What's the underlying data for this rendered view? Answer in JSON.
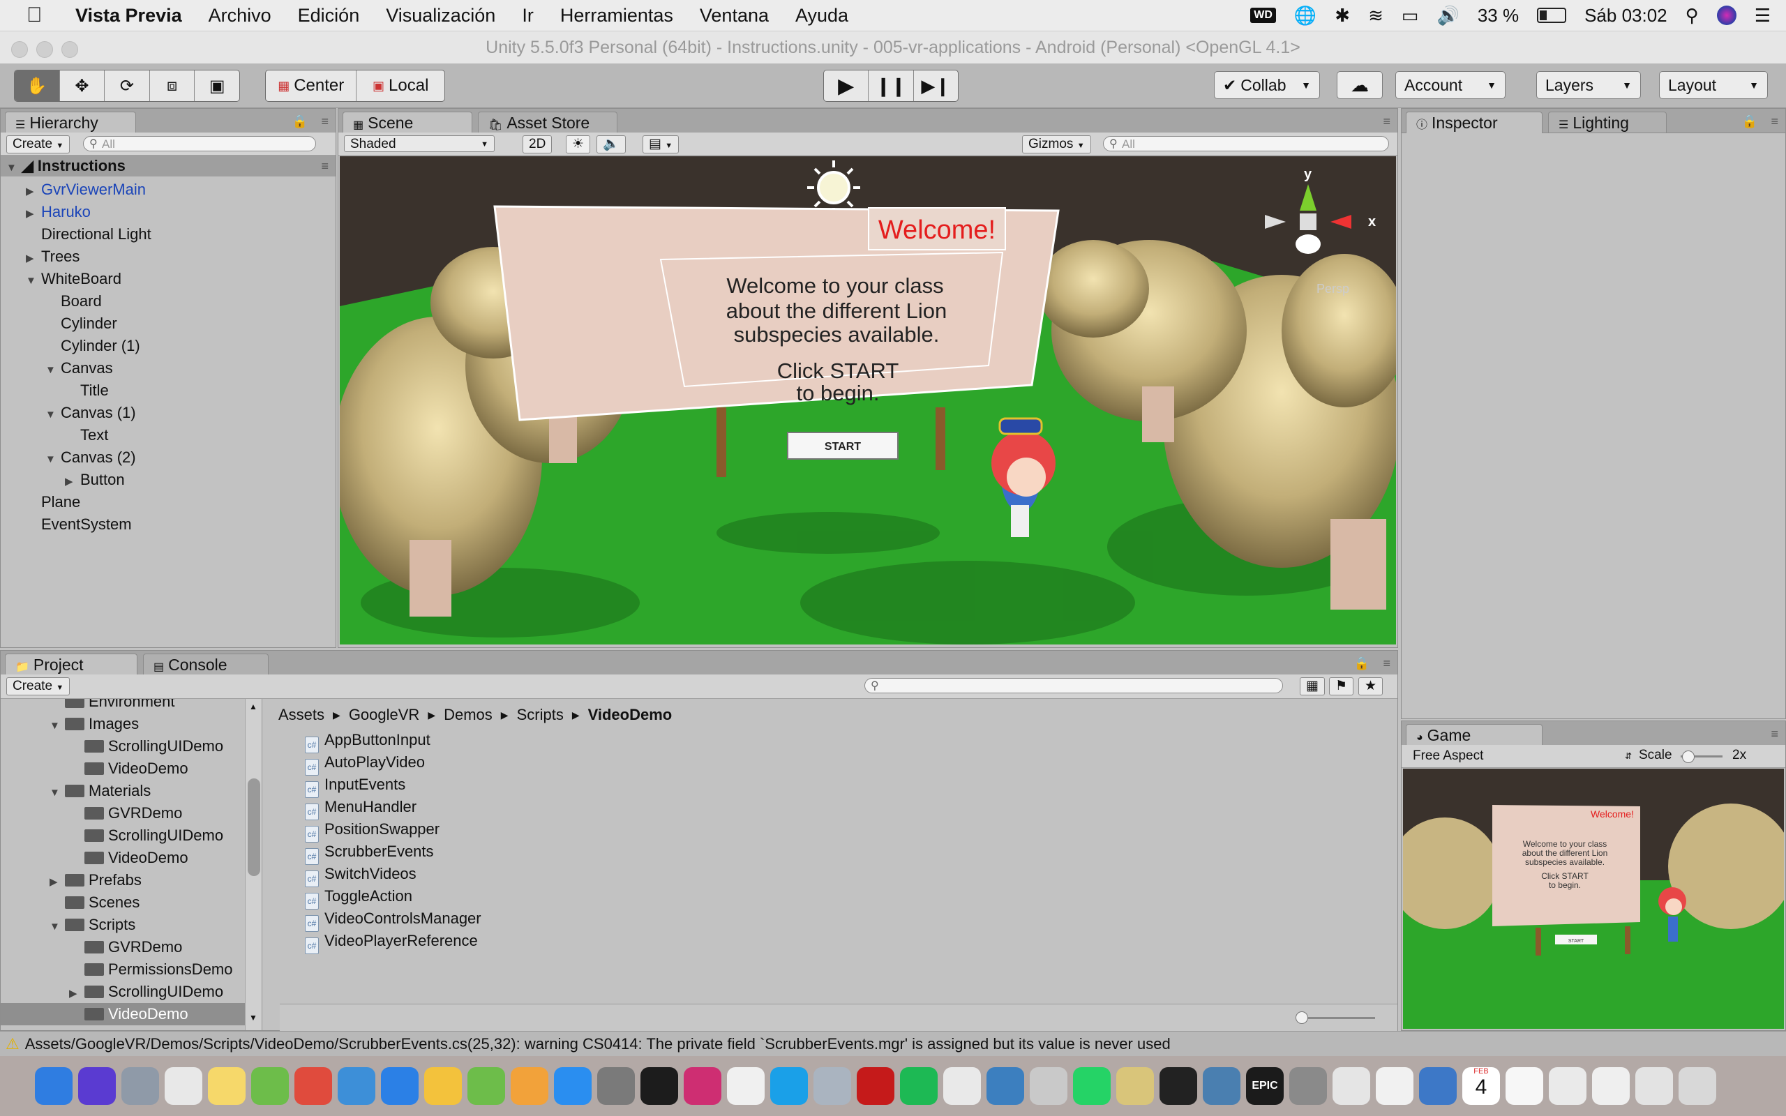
{
  "menubar": {
    "app": "Vista Previa",
    "items": [
      "Archivo",
      "Edición",
      "Visualización",
      "Ir",
      "Herramientas",
      "Ventana",
      "Ayuda"
    ],
    "wd_label": "WD",
    "battery": "33 %",
    "clock": "Sáb 03:02"
  },
  "window": {
    "title": "Unity 5.5.0f3 Personal (64bit) - Instructions.unity - 005-vr-applications - Android (Personal) <OpenGL 4.1>"
  },
  "toolbar": {
    "tools": [
      "hand-tool-icon",
      "move-tool-icon",
      "rotate-tool-icon",
      "scale-tool-icon",
      "rect-tool-icon"
    ],
    "pivot": "Center",
    "space": "Local",
    "collab": "Collab",
    "account": "Account",
    "layers": "Layers",
    "layout": "Layout"
  },
  "hierarchy": {
    "tab": "Hierarchy",
    "create": "Create",
    "search_placeholder": "All",
    "scene_name": "Instructions",
    "items": [
      {
        "label": "GvrViewerMain",
        "depth": 0,
        "arrow": "collapsed",
        "prefab": true
      },
      {
        "label": "Haruko",
        "depth": 0,
        "arrow": "collapsed",
        "prefab": true
      },
      {
        "label": "Directional Light",
        "depth": 0,
        "arrow": "none",
        "prefab": false
      },
      {
        "label": "Trees",
        "depth": 0,
        "arrow": "collapsed",
        "prefab": false
      },
      {
        "label": "WhiteBoard",
        "depth": 0,
        "arrow": "expanded",
        "prefab": false
      },
      {
        "label": "Board",
        "depth": 1,
        "arrow": "none",
        "prefab": false
      },
      {
        "label": "Cylinder",
        "depth": 1,
        "arrow": "none",
        "prefab": false
      },
      {
        "label": "Cylinder (1)",
        "depth": 1,
        "arrow": "none",
        "prefab": false
      },
      {
        "label": "Canvas",
        "depth": 1,
        "arrow": "expanded",
        "prefab": false
      },
      {
        "label": "Title",
        "depth": 2,
        "arrow": "none",
        "prefab": false
      },
      {
        "label": "Canvas (1)",
        "depth": 1,
        "arrow": "expanded",
        "prefab": false
      },
      {
        "label": "Text",
        "depth": 2,
        "arrow": "none",
        "prefab": false
      },
      {
        "label": "Canvas (2)",
        "depth": 1,
        "arrow": "expanded",
        "prefab": false
      },
      {
        "label": "Button",
        "depth": 2,
        "arrow": "collapsed",
        "prefab": false
      },
      {
        "label": "Plane",
        "depth": 0,
        "arrow": "none",
        "prefab": false
      },
      {
        "label": "EventSystem",
        "depth": 0,
        "arrow": "none",
        "prefab": false
      }
    ]
  },
  "scene": {
    "tabs": [
      "Scene",
      "Asset Store"
    ],
    "shading": "Shaded",
    "mode_2d": "2D",
    "gizmos": "Gizmos",
    "search_placeholder": "All",
    "gizmo_y": "y",
    "gizmo_x": "x",
    "gizmo_persp": "Persp",
    "board": {
      "title": "Welcome!",
      "line1": "Welcome to your class",
      "line2": "about the different Lion",
      "line3": "subspecies available.",
      "line4": "Click START",
      "line5": "to begin.",
      "button": "START"
    }
  },
  "inspector": {
    "tabs": [
      "Inspector",
      "Lighting"
    ]
  },
  "project": {
    "tabs": [
      "Project",
      "Console"
    ],
    "create": "Create",
    "tree": [
      {
        "label": "Environment",
        "depth": 1,
        "arrow": "none"
      },
      {
        "label": "Images",
        "depth": 1,
        "arrow": "expanded"
      },
      {
        "label": "ScrollingUIDemo",
        "depth": 2,
        "arrow": "none"
      },
      {
        "label": "VideoDemo",
        "depth": 2,
        "arrow": "none"
      },
      {
        "label": "Materials",
        "depth": 1,
        "arrow": "expanded"
      },
      {
        "label": "GVRDemo",
        "depth": 2,
        "arrow": "none"
      },
      {
        "label": "ScrollingUIDemo",
        "depth": 2,
        "arrow": "none"
      },
      {
        "label": "VideoDemo",
        "depth": 2,
        "arrow": "none"
      },
      {
        "label": "Prefabs",
        "depth": 1,
        "arrow": "collapsed"
      },
      {
        "label": "Scenes",
        "depth": 1,
        "arrow": "none"
      },
      {
        "label": "Scripts",
        "depth": 1,
        "arrow": "expanded"
      },
      {
        "label": "GVRDemo",
        "depth": 2,
        "arrow": "none"
      },
      {
        "label": "PermissionsDemo",
        "depth": 2,
        "arrow": "none"
      },
      {
        "label": "ScrollingUIDemo",
        "depth": 2,
        "arrow": "collapsed"
      },
      {
        "label": "VideoDemo",
        "depth": 2,
        "arrow": "none",
        "selected": true
      }
    ],
    "breadcrumb": [
      "Assets",
      "GoogleVR",
      "Demos",
      "Scripts",
      "VideoDemo"
    ],
    "files": [
      "AppButtonInput",
      "AutoPlayVideo",
      "InputEvents",
      "MenuHandler",
      "PositionSwapper",
      "ScrubberEvents",
      "SwitchVideos",
      "ToggleAction",
      "VideoControlsManager",
      "VideoPlayerReference"
    ]
  },
  "game": {
    "tab": "Game",
    "aspect": "Free Aspect",
    "scale_label": "Scale",
    "scale_value": "2x"
  },
  "status": {
    "message": "Assets/GoogleVR/Demos/Scripts/VideoDemo/ScrubberEvents.cs(25,32): warning CS0414: The private field `ScrubberEvents.mgr' is assigned but its value is never used"
  },
  "dock": {
    "calendar_month": "FEB",
    "calendar_day": "4",
    "epic_label": "EPIC",
    "icons": [
      "finder-icon",
      "siri-icon",
      "launchpad-icon",
      "app-grid-icon",
      "notes-icon",
      "android-studio-icon",
      "chrome-icon",
      "xcode-icon",
      "safari-icon",
      "tips-icon",
      "android-studio-icon-2",
      "ibooks-icon",
      "app-store-icon",
      "system-prefs-icon",
      "terminal-icon",
      "intellij-icon",
      "itunes-icon",
      "skype-icon",
      "image-capture-icon",
      "acrobat-icon",
      "spotify-icon",
      "sublime-icon",
      "browser-icon",
      "script-editor-icon",
      "whatsapp-icon",
      "file-merge-icon",
      "unity-icon",
      "netbeans-icon",
      "epic-games-icon",
      "migration-icon",
      "disc-icon",
      "photos-icon",
      "network-icon",
      "calendar-icon",
      "textedit-icon",
      "preview-doc-icon",
      "document-icon",
      "document-icon-2",
      "trash-icon"
    ]
  }
}
